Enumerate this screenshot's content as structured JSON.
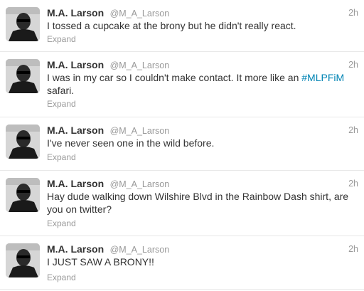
{
  "author": {
    "name": "M.A. Larson",
    "handle": "@M_A_Larson"
  },
  "expand_label": "Expand",
  "tweets": [
    {
      "time": "2h",
      "text": "I tossed a cupcake at the brony but he didn't really react."
    },
    {
      "time": "2h",
      "text_before": "I was in my car so I couldn't make contact. It more like an ",
      "hashtag": "#MLPFiM",
      "text_after": " safari."
    },
    {
      "time": "2h",
      "text": "I've never seen one in the wild before."
    },
    {
      "time": "2h",
      "text": "Hay dude walking down Wilshire Blvd in the Rainbow Dash shirt, are you on twitter?"
    },
    {
      "time": "2h",
      "text": "I JUST SAW A BRONY!!"
    }
  ],
  "colors": {
    "text": "#333333",
    "meta": "#999999",
    "link": "#0084b4",
    "divider": "#e8e8e8"
  }
}
